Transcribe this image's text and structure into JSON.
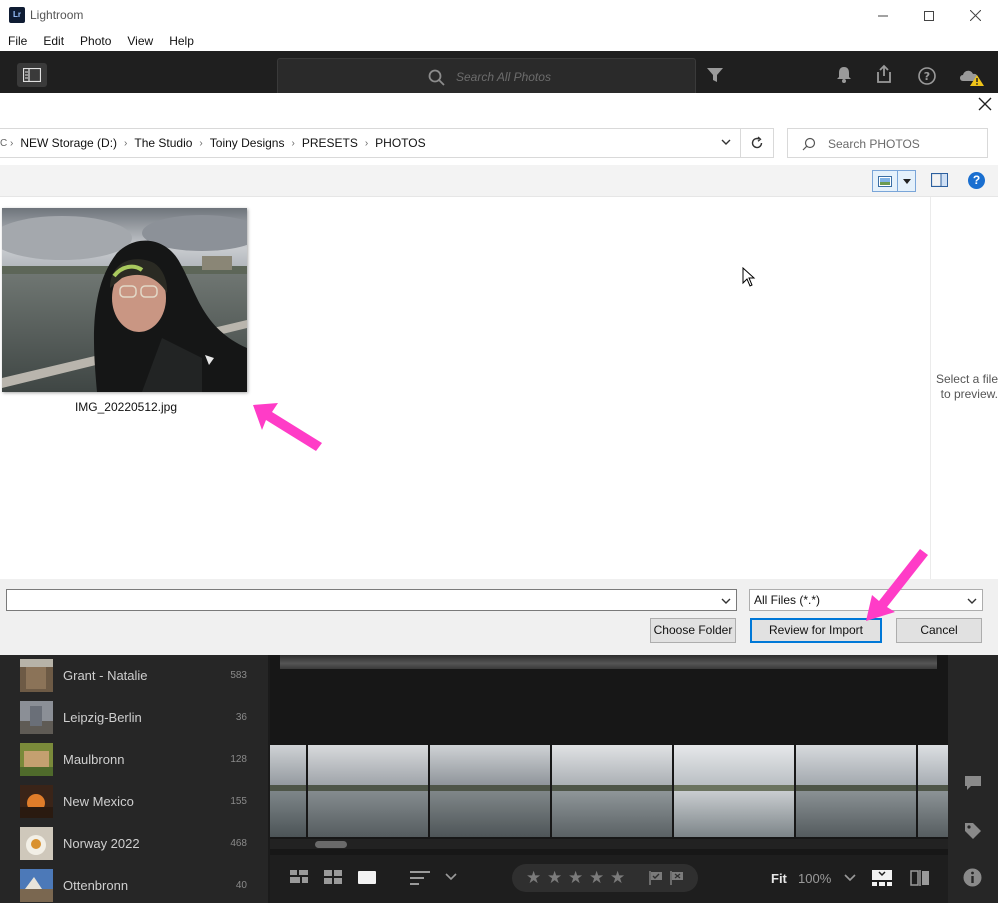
{
  "window": {
    "title": "Lightroom",
    "logo_text": "Lr"
  },
  "menu": [
    "File",
    "Edit",
    "Photo",
    "View",
    "Help"
  ],
  "lr_toolbar": {
    "search_placeholder": "Search All Photos"
  },
  "dialog": {
    "breadcrumbs": [
      "NEW Storage (D:)",
      "The Studio",
      "Toiny Designs",
      "PRESETS",
      "PHOTOS"
    ],
    "search_placeholder": "Search PHOTOS",
    "file": {
      "name": "IMG_20220512.jpg"
    },
    "preview_text": "Select a file to preview.",
    "filename_value": "",
    "filetype": "All Files (*.*)",
    "buttons": {
      "choose_folder": "Choose Folder",
      "review": "Review for Import",
      "cancel": "Cancel"
    },
    "help_label": "?"
  },
  "albums": [
    {
      "name": "Grant - Natalie",
      "count": "583"
    },
    {
      "name": "Leipzig-Berlin",
      "count": "36"
    },
    {
      "name": "Maulbronn",
      "count": "128"
    },
    {
      "name": "New Mexico",
      "count": "155"
    },
    {
      "name": "Norway 2022",
      "count": "468"
    },
    {
      "name": "Ottenbronn",
      "count": "40"
    }
  ],
  "bottombar": {
    "fit": "Fit",
    "zoom": "100%"
  },
  "colors": {
    "annotation_arrow": "#ff3cc7",
    "accent_blue": "#1a6fd0"
  }
}
